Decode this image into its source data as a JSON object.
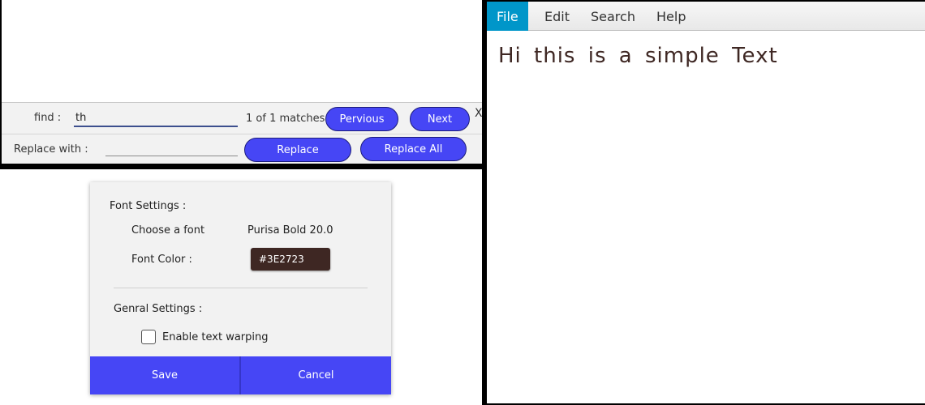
{
  "find_panel": {
    "find_label": "find :",
    "find_value": "th",
    "match_status": "1 of 1 matches",
    "previous_label": "Pervious",
    "next_label": "Next",
    "close_label": "X",
    "replace_label": "Replace with :",
    "replace_value": "",
    "replace_button": "Replace",
    "replace_all_button": "Replace All"
  },
  "settings_dialog": {
    "font_section": "Font Settings :",
    "choose_font_label": "Choose a font",
    "font_value": "Purisa Bold 20.0",
    "font_color_label": "Font Color :",
    "font_color_value": "#3E2723",
    "general_section": "Genral Settings :",
    "wrap_label": "Enable text warping",
    "wrap_checked": false,
    "save_label": "Save",
    "cancel_label": "Cancel"
  },
  "editor": {
    "menu": [
      {
        "label": "File",
        "active": true
      },
      {
        "label": "Edit",
        "active": false
      },
      {
        "label": "Search",
        "active": false
      },
      {
        "label": "Help",
        "active": false
      }
    ],
    "content": "Hi this is a simple Text"
  },
  "colors": {
    "accent_button": "#4646f5",
    "menu_active": "#0096c9",
    "text_color": "#3E2723"
  }
}
